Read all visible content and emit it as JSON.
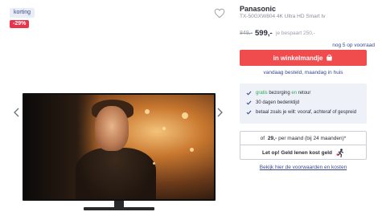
{
  "gallery": {
    "badge_korting": "korting",
    "badge_percent": "-29%",
    "favorite_icon": "heart-icon",
    "prev_icon": "chevron-left-icon",
    "next_icon": "chevron-right-icon"
  },
  "product": {
    "brand": "Panasonic",
    "model": "TX-50GXW804 4K Ultra HD Smart tv",
    "old_price": "849,-",
    "price": "599,-",
    "saving": "je bespaart 250,-",
    "stock": "nog 5 op voorraad"
  },
  "cart": {
    "label": "in winkelmandje",
    "icon": "shopping-bag-icon",
    "delivery": "vandaag besteld, maandag in huis"
  },
  "usps": [
    {
      "prefix": "gratis",
      "text_a": " bezorging ",
      "em": "en",
      "text_b": " retour"
    },
    {
      "prefix": "",
      "text_a": "30 dagen bedenktijd",
      "em": "",
      "text_b": ""
    },
    {
      "prefix": "",
      "text_a": "betaal zoals je wilt: vooraf, achteraf of gespreid",
      "em": "",
      "text_b": ""
    }
  ],
  "credit": {
    "pre": "of",
    "amount": "29,-",
    "post": "per maand (bij 24 maanden)*",
    "warning": "Let op! Geld lenen kost geld",
    "warning_icon": "running-man-icon",
    "terms_link": "Bekijk hier de voorwaarden en kosten"
  },
  "colors": {
    "accent": "#f04b4d",
    "discount": "#e8334a",
    "link": "#3a4a8c",
    "check": "#2fa84f"
  }
}
